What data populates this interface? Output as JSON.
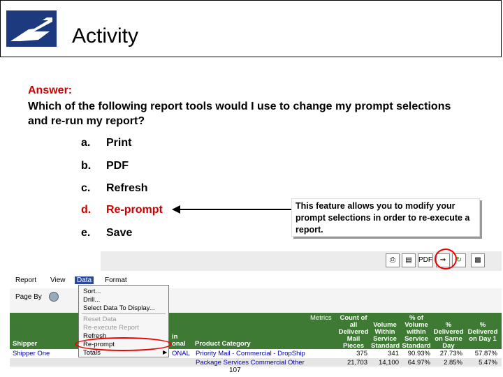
{
  "header": {
    "title": "Activity"
  },
  "content": {
    "answer_label": "Answer:",
    "question": "Which of the following report tools would I use to change my prompt selections and re-run my report?",
    "options": [
      {
        "letter": "a.",
        "text": "Print"
      },
      {
        "letter": "b.",
        "text": "PDF"
      },
      {
        "letter": "c.",
        "text": "Refresh"
      },
      {
        "letter": "d.",
        "text": "Re-prompt"
      },
      {
        "letter": "e.",
        "text": "Save"
      }
    ],
    "callout": "This feature allows you to modify your prompt selections in order to re-execute a report."
  },
  "screenshot": {
    "toolbar": {
      "pdf_label": "PDF"
    },
    "menu": [
      "Report",
      "View",
      "Data",
      "Format"
    ],
    "page_by": "Page By",
    "data_menu": [
      "Sort...",
      "Drill...",
      "Select Data To Display...",
      "Reset Data",
      "Re-execute Report",
      "Refresh",
      "Re-prompt",
      "Totals"
    ],
    "metrics_label": "Metrics",
    "headers": {
      "shipper": "Shipper",
      "in": "in",
      "onal": "onal",
      "product_category": "Product Category",
      "count": "Count of all Delivered Mail Pieces",
      "volume": "Volume Within Service Standard",
      "pct_volume": "% of Volume within Service Standard",
      "delivered_same_day": "% Delivered on Same Day",
      "delivered_day1": "% Delivered on Day 1"
    },
    "rows": [
      {
        "shipper": "Shipper One",
        "code": "ONAL",
        "category": "Priority Mail - Commercial - DropShip",
        "count": "375",
        "volume": "341",
        "pct": "90.93%",
        "same_day": "27.73%",
        "day1": "57.87%"
      },
      {
        "shipper": "",
        "code": "",
        "category": "Package Services  Commercial  Other",
        "count": "21,703",
        "volume": "14,100",
        "pct": "64.97%",
        "same_day": "2.85%",
        "day1": "5.47%"
      }
    ]
  },
  "footer": {
    "page_number": "107"
  },
  "colors": {
    "accent_red": "#cc0000",
    "usps_blue": "#1d3a7e",
    "report_green": "#3f7a35"
  }
}
